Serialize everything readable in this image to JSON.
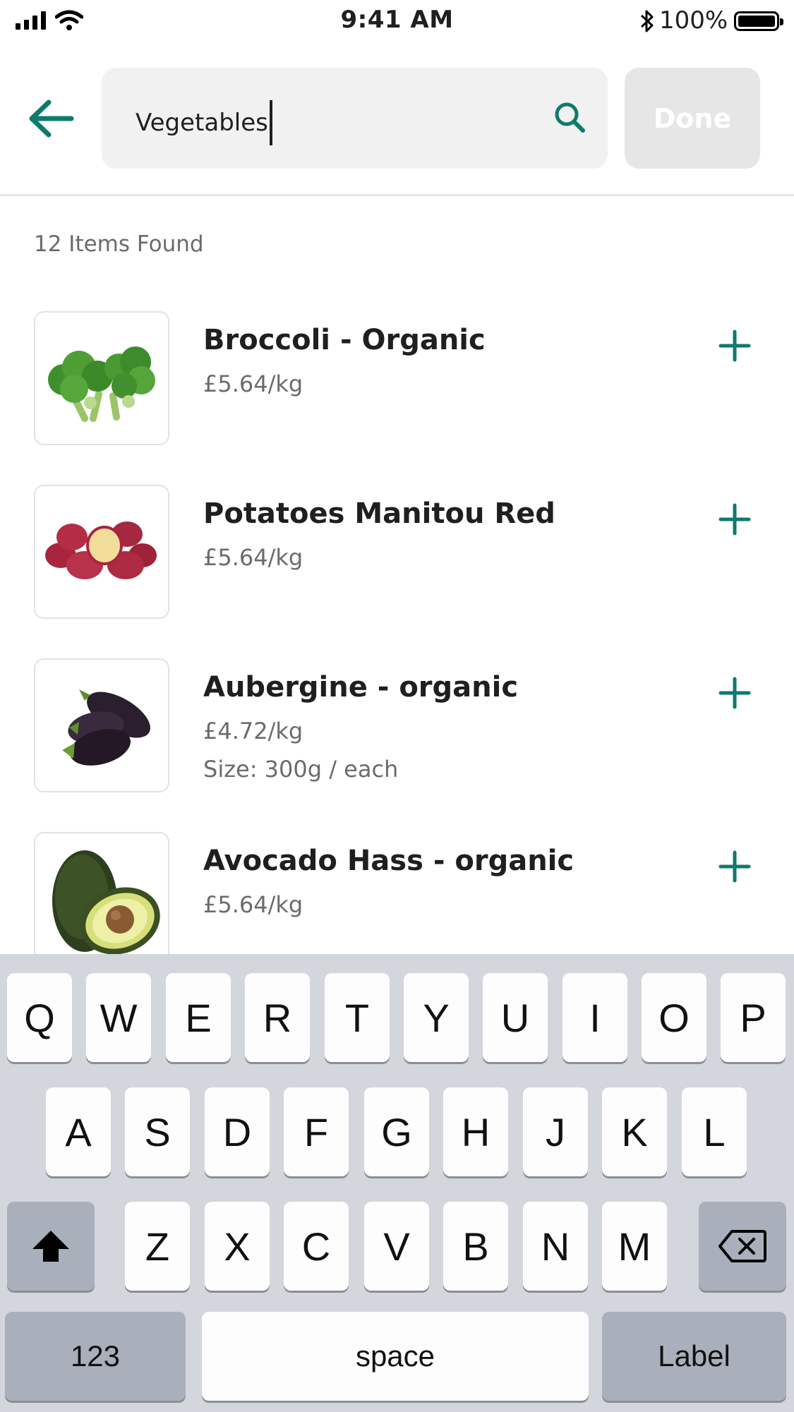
{
  "status_bar": {
    "time": "9:41 AM",
    "battery_percent": "100%",
    "battery_level": 1.0
  },
  "search": {
    "value": "Vegetables",
    "icon": "search-icon",
    "done_label": "Done"
  },
  "results": {
    "count_label": "12 Items Found",
    "items": [
      {
        "name": "Broccoli - Organic",
        "price": "£5.64/kg",
        "size": "",
        "image": "broccoli"
      },
      {
        "name": "Potatoes Manitou Red",
        "price": "£5.64/kg",
        "size": "",
        "image": "red-potatoes"
      },
      {
        "name": "Aubergine - organic",
        "price": "£4.72/kg",
        "size": "Size: 300g / each",
        "image": "aubergine"
      },
      {
        "name": "Avocado Hass - organic",
        "price": "£5.64/kg",
        "size": "",
        "image": "avocado"
      }
    ]
  },
  "keyboard": {
    "row1": [
      "Q",
      "W",
      "E",
      "R",
      "T",
      "Y",
      "U",
      "I",
      "O",
      "P"
    ],
    "row2": [
      "A",
      "S",
      "D",
      "F",
      "G",
      "H",
      "J",
      "K",
      "L"
    ],
    "row3": [
      "Z",
      "X",
      "C",
      "V",
      "B",
      "N",
      "M"
    ],
    "numbers_label": "123",
    "space_label": "space",
    "return_label": "Label",
    "shift_icon": "shift-icon",
    "delete_icon": "backspace-icon"
  },
  "colors": {
    "accent": "#0e7a6d",
    "search_bg": "#f1f1f1",
    "done_bg": "#e6e6e6",
    "keyboard_bg": "#d3d6dc"
  }
}
